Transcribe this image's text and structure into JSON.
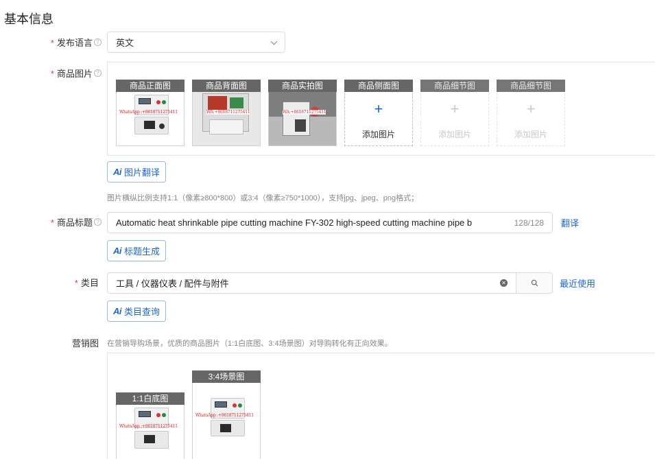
{
  "section_title": "基本信息",
  "language": {
    "label": "发布语言",
    "required_mark": "*",
    "help_icon": "question-circle-icon",
    "value": "英文"
  },
  "product_images": {
    "label": "商品图片",
    "required_mark": "*",
    "help_icon": "question-circle-icon",
    "slots": [
      {
        "title": "商品正面图",
        "state": "filled",
        "watermark": "WhatsApp :+8618711275411"
      },
      {
        "title": "商品背面图",
        "state": "filled",
        "watermark": "WA:+8618711275411"
      },
      {
        "title": "商品实拍图",
        "state": "filled",
        "watermark": "WA:+8618711275411"
      },
      {
        "title": "商品侧面图",
        "state": "empty",
        "plus": "+",
        "add_text": "添加图片"
      },
      {
        "title": "商品细节图",
        "state": "disabled",
        "plus": "+",
        "add_text": "添加图片"
      },
      {
        "title": "商品细节图",
        "state": "disabled",
        "plus": "+",
        "add_text": "添加图片"
      }
    ],
    "ai_button": {
      "mark": "Ai",
      "label": "图片翻译"
    },
    "hint": "图片横纵比例支持1:1（像素≥800*800）或3:4（像素≥750*1000），支持jpg、jpeg、png格式；"
  },
  "product_title": {
    "label": "商品标题",
    "required_mark": "*",
    "help_icon": "question-circle-icon",
    "value": "Automatic heat shrinkable pipe cutting machine FY-302 high-speed cutting machine pipe b",
    "counter": "128/128",
    "translate_link": "翻译",
    "ai_button": {
      "mark": "Ai",
      "label": "标题生成"
    }
  },
  "category": {
    "label": "类目",
    "required_mark": "*",
    "value": "工具 / 仪器仪表 / 配件与附件",
    "clear_icon": "clear-circle-icon",
    "search_icon": "search-icon",
    "recent_link": "最近使用",
    "ai_button": {
      "mark": "Ai",
      "label": "类目查询"
    }
  },
  "marketing": {
    "label": "营销图",
    "hint": "在营销导购场景，优质的商品图片（1:1白底图、3:4场景图）对导购转化有正向效果。",
    "slots": [
      {
        "title": "1:1白底图",
        "watermark": "WhatsApp :+8618711275411"
      },
      {
        "title": "3:4场景图",
        "watermark": "WhatsApp :+8618711275411"
      }
    ]
  },
  "colors": {
    "accent": "#1e64d4",
    "required": "#e23b3b",
    "slot_header": "#666666"
  }
}
